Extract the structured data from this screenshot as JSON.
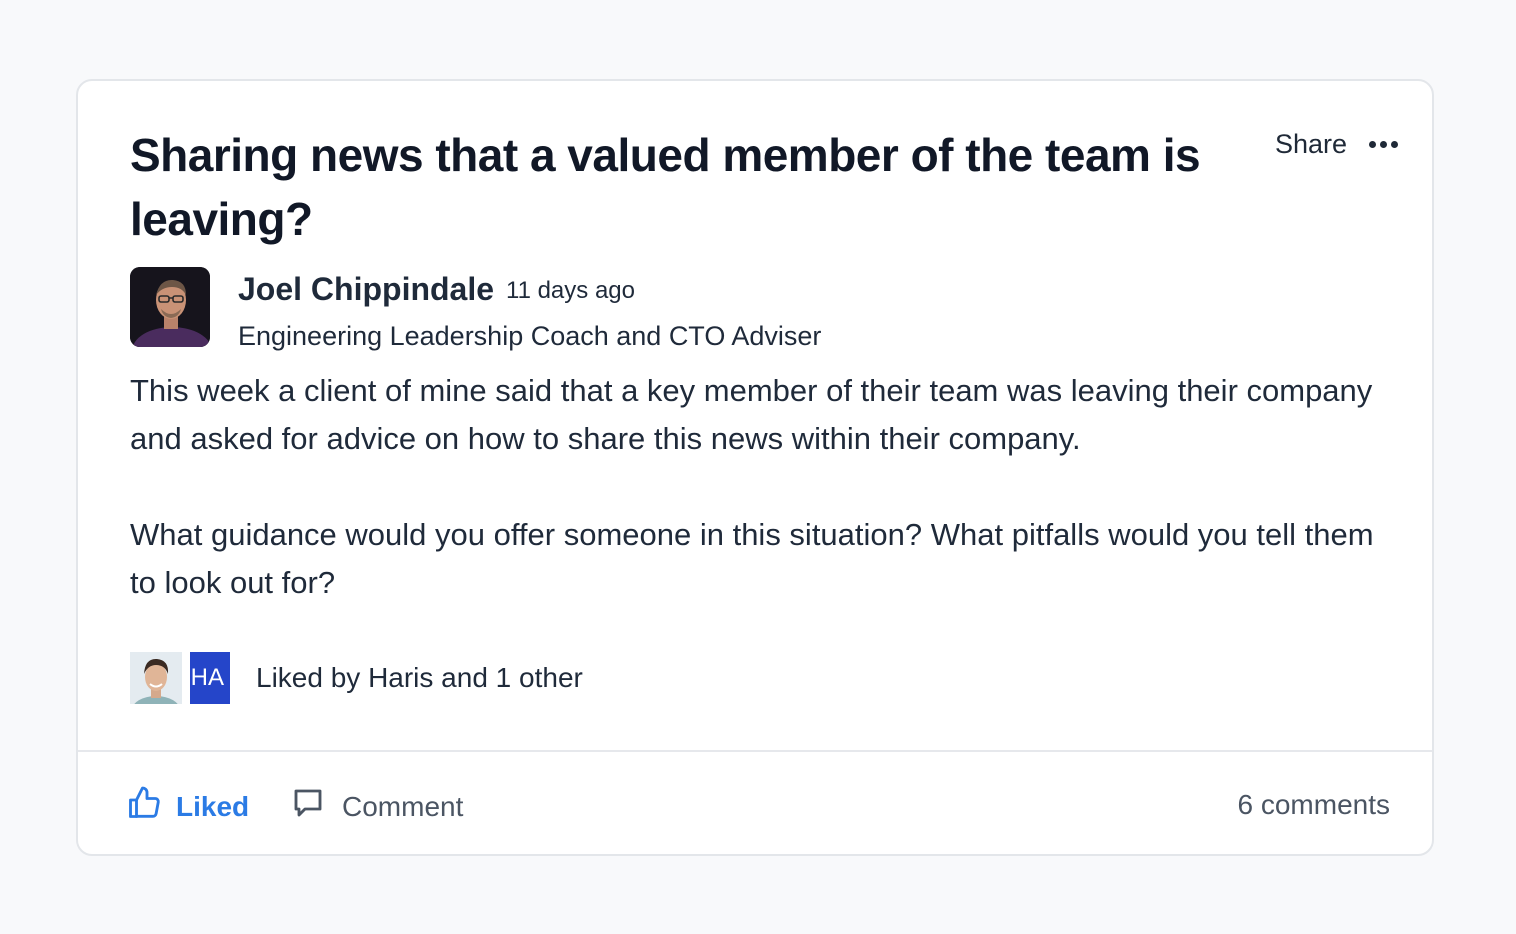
{
  "post": {
    "title": "Sharing news that a valued member of the team is leaving?",
    "share_label": "Share",
    "more_icon": "more-horizontal-icon",
    "author": {
      "name": "Joel Chippindale",
      "timestamp": "11 days ago",
      "role": "Engineering Leadership Coach and CTO Adviser"
    },
    "body": [
      "This week a client of mine said that a key member of their team was leaving their company and asked for advice on how to share this news within their company.",
      "What guidance would you offer someone in this situation? What pitfalls would you tell them to look out for?"
    ],
    "likes": {
      "initials": "HA",
      "text": "Liked by Haris and 1 other"
    },
    "actions": {
      "liked_label": "Liked",
      "comment_label": "Comment",
      "comments_count": "6 comments"
    }
  },
  "colors": {
    "accent": "#2b7be5",
    "initials_bg": "#2545c9",
    "page_bg": "#f8f9fb"
  }
}
